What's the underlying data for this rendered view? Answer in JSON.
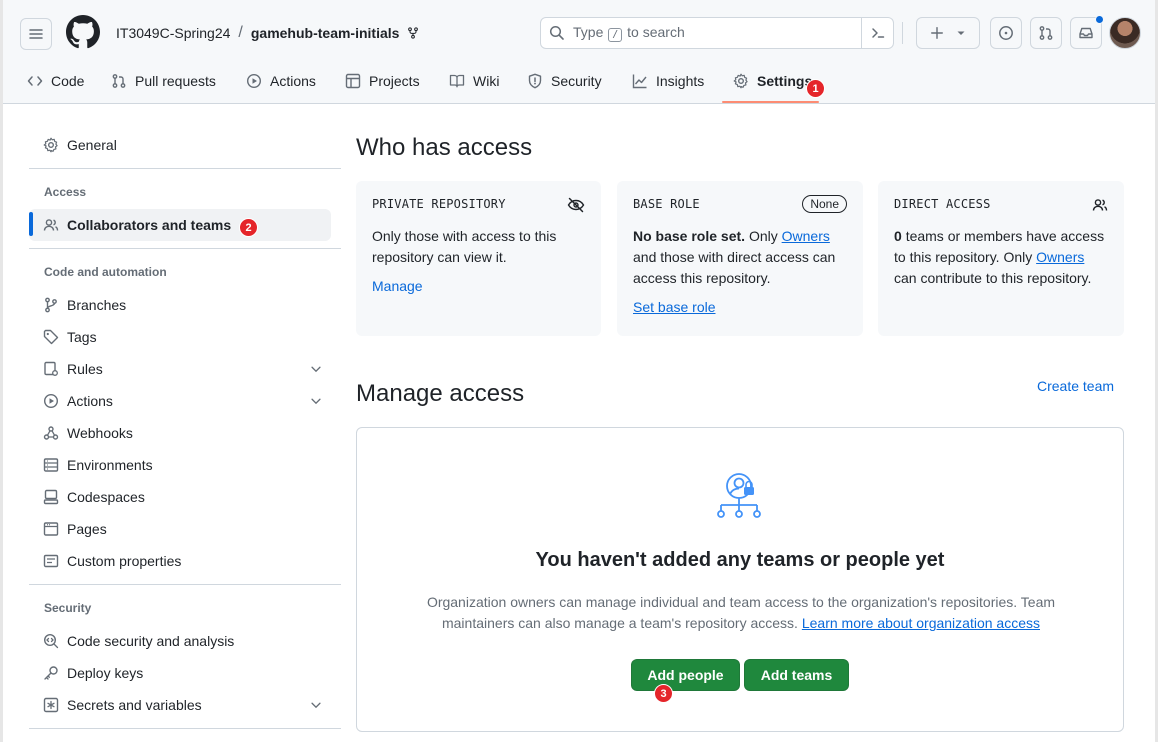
{
  "header": {
    "owner": "IT3049C-Spring24",
    "separator": "/",
    "repo": "gamehub-team-initials",
    "search": {
      "prefix": "Type",
      "key": "/",
      "suffix": "to search"
    }
  },
  "tabs": [
    {
      "label": "Code",
      "icon": "code-icon"
    },
    {
      "label": "Pull requests",
      "icon": "pull-request-icon"
    },
    {
      "label": "Actions",
      "icon": "play-icon"
    },
    {
      "label": "Projects",
      "icon": "table-icon"
    },
    {
      "label": "Wiki",
      "icon": "book-icon"
    },
    {
      "label": "Security",
      "icon": "shield-icon"
    },
    {
      "label": "Insights",
      "icon": "graph-icon"
    },
    {
      "label": "Settings",
      "icon": "gear-icon",
      "active": true
    }
  ],
  "badges": {
    "one": "1",
    "two": "2",
    "three": "3"
  },
  "sidebar": {
    "general": "General",
    "access_heading": "Access",
    "collaborators": "Collaborators and teams",
    "code_automation_heading": "Code and automation",
    "items": [
      "Branches",
      "Tags",
      "Rules",
      "Actions",
      "Webhooks",
      "Environments",
      "Codespaces",
      "Pages",
      "Custom properties"
    ],
    "security_heading": "Security",
    "security_items": [
      "Code security and analysis",
      "Deploy keys",
      "Secrets and variables"
    ]
  },
  "main": {
    "who_title": "Who has access",
    "cards": {
      "private": {
        "label": "PRIVATE REPOSITORY",
        "text": "Only those with access to this repository can view it.",
        "link": "Manage"
      },
      "base": {
        "label": "BASE ROLE",
        "pill": "None",
        "bold": "No base role set.",
        "text_a": "Only",
        "owners": "Owners",
        "text_b": "and those with direct access can access this repository.",
        "link": "Set base role"
      },
      "direct": {
        "label": "DIRECT ACCESS",
        "count": "0",
        "text_a": "teams or members have access to this repository. Only",
        "owners": "Owners",
        "text_b": "can contribute to this repository."
      }
    },
    "manage_title": "Manage access",
    "create_team": "Create team",
    "empty": {
      "title": "You haven't added any teams or people yet",
      "desc": "Organization owners can manage individual and team access to the organization's repositories. Team maintainers can also manage a team's repository access.",
      "link": "Learn more about organization access",
      "add_people": "Add people",
      "add_teams": "Add teams"
    }
  },
  "colors": {
    "accent": "#0969da",
    "green": "#1f883d",
    "badge_red": "#e5252a",
    "tab_underline": "#fd8c73"
  }
}
